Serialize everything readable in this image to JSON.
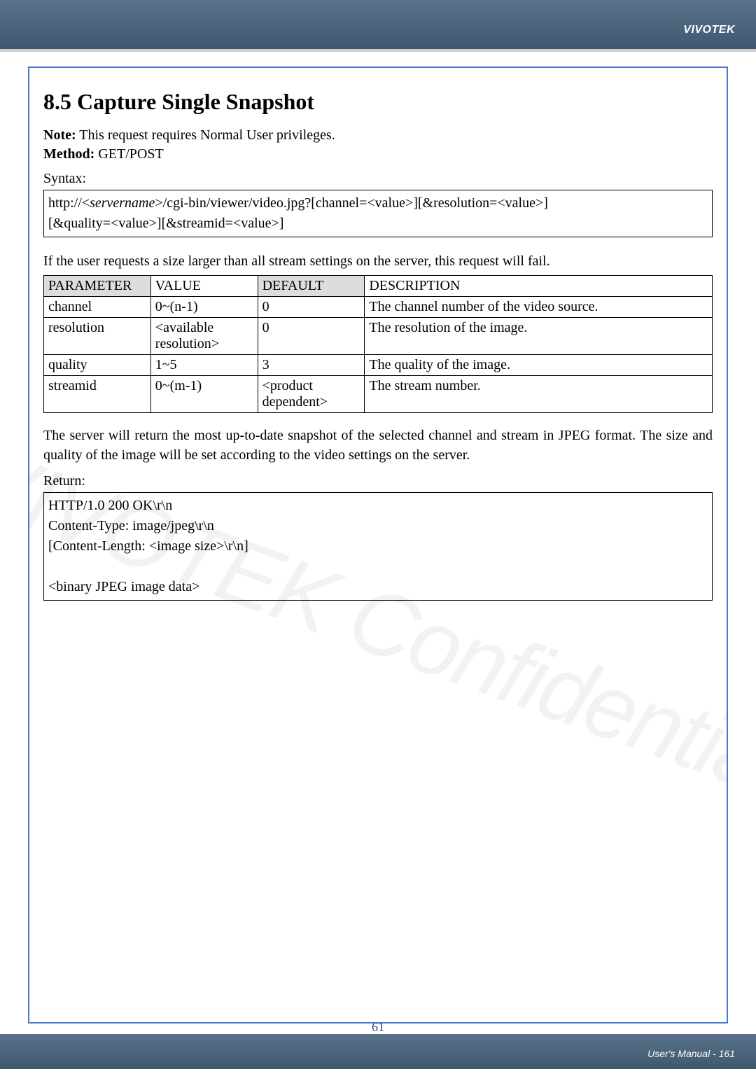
{
  "header": {
    "brand": "VIVOTEK"
  },
  "section": {
    "number": "8.5",
    "title": "Capture Single Snapshot",
    "note_label": "Note:",
    "note_text": " This request requires Normal User privileges.",
    "method_label": "Method:",
    "method_value": " GET/POST"
  },
  "syntax_label": "Syntax:",
  "syntax_box": {
    "line1_prefix": "http://<",
    "line1_server": "servername",
    "line1_suffix": ">/cgi-bin/viewer/video.jpg?[channel=<value>][&resolution=<value>]",
    "line2": "[&quality=<value>][&streamid=<value>]"
  },
  "fail_text": "If the user requests a size larger than all stream settings on the server, this request will fail.",
  "table": {
    "headers": {
      "param": "PARAMETER",
      "value": "VALUE",
      "default": "DEFAULT",
      "desc": "DESCRIPTION"
    },
    "rows": [
      {
        "param": "channel",
        "value": "0~(n-1)",
        "default": "0",
        "desc": "The channel number of the video source."
      },
      {
        "param": "resolution",
        "value": "<available resolution>",
        "default": "0",
        "desc": "The resolution of the image."
      },
      {
        "param": "quality",
        "value": "1~5",
        "default": "3",
        "desc": "The quality of the image."
      },
      {
        "param": "streamid",
        "value": "0~(m-1)",
        "default": "<product dependent>",
        "desc": "The stream number."
      }
    ]
  },
  "body1": "The server will return the most up-to-date snapshot of the selected channel and stream in JPEG format. The size and quality of the image will be set according to the video settings on the server.",
  "return_label": "Return:",
  "return_box": {
    "l1": "HTTP/1.0 200 OK\\r\\n",
    "l2": "Content-Type: image/jpeg\\r\\n",
    "l3": "[Content-Length: <image size>\\r\\n]",
    "l4": "",
    "l5": "<binary JPEG image data>"
  },
  "watermark": "VIVOTEK Confidential",
  "footer": {
    "page_num": "61",
    "manual": "User's Manual - 161"
  }
}
